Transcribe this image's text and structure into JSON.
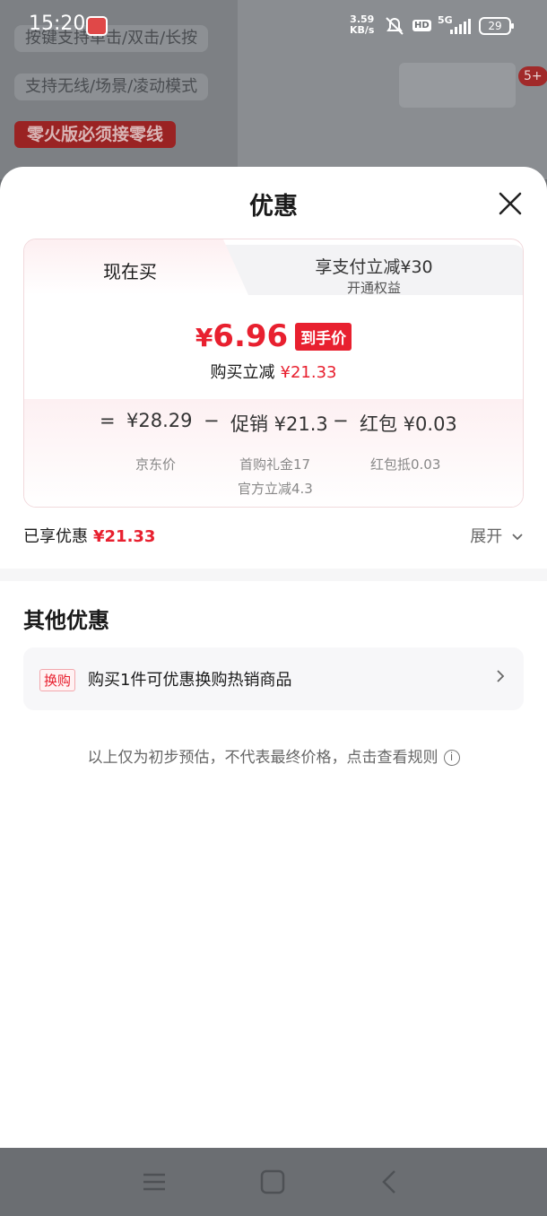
{
  "background_app": {
    "feature_pill_1": "按键支持单击/双击/长按",
    "feature_pill_2": "支持无线/场景/凌动模式",
    "promo_banner": "零火版必须接零线",
    "notification_badge": "5+"
  },
  "status_bar": {
    "time": "15:20",
    "net_speed_value": "3.59",
    "net_speed_unit": "KB/s",
    "hd_label": "HD",
    "network_label": "5G",
    "battery_level": "29"
  },
  "sheet": {
    "title": "优惠",
    "tabs": {
      "buy_now": "现在买",
      "pay_discount_title": "享支付立减¥30",
      "pay_discount_sub": "开通权益"
    },
    "final_price": {
      "currency": "¥",
      "value": "6.96",
      "tag": "到手价"
    },
    "instant_save": {
      "label": "购买立减",
      "amount": "¥21.33"
    },
    "breakdown": {
      "equals": "=",
      "jd_price": "¥28.29",
      "jd_price_label": "京东价",
      "minus_1": "−",
      "promo": "促销 ¥21.3",
      "promo_detail_1": "首购礼金17",
      "promo_detail_2": "官方立减4.3",
      "minus_2": "−",
      "redpacket": "红包 ¥0.03",
      "redpacket_detail": "红包抵0.03"
    },
    "enjoyed": {
      "label": "已享优惠",
      "amount": "¥21.33",
      "expand": "展开"
    },
    "other_offers": {
      "title": "其他优惠",
      "items": [
        {
          "tag": "换购",
          "text": "购买1件可优惠换购热销商品"
        }
      ]
    },
    "disclaimer": "以上仅为初步预估，不代表最终价格，点击查看规则"
  },
  "colors": {
    "accent_red": "#e8202f",
    "overlay": "#6b6e72"
  }
}
